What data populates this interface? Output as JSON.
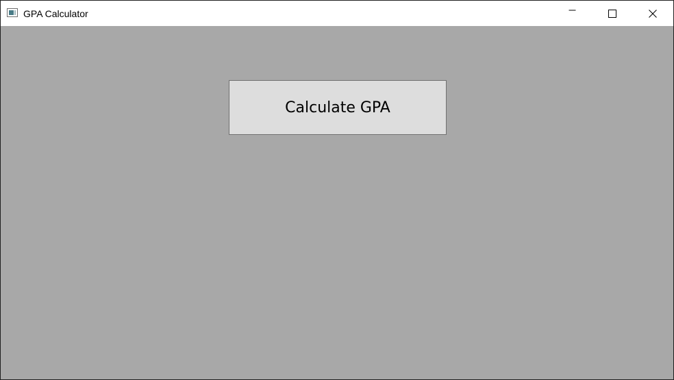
{
  "window": {
    "title": "GPA Calculator",
    "icon": "app-window-icon",
    "controls": {
      "minimize_icon": "minimize-icon",
      "maximize_icon": "maximize-icon",
      "close_icon": "close-icon"
    }
  },
  "main": {
    "calculate_button_label": "Calculate GPA"
  },
  "colors": {
    "client_background": "#a8a8a8",
    "button_background": "#dddddd",
    "button_border": "#707070",
    "titlebar_background": "#ffffff"
  }
}
